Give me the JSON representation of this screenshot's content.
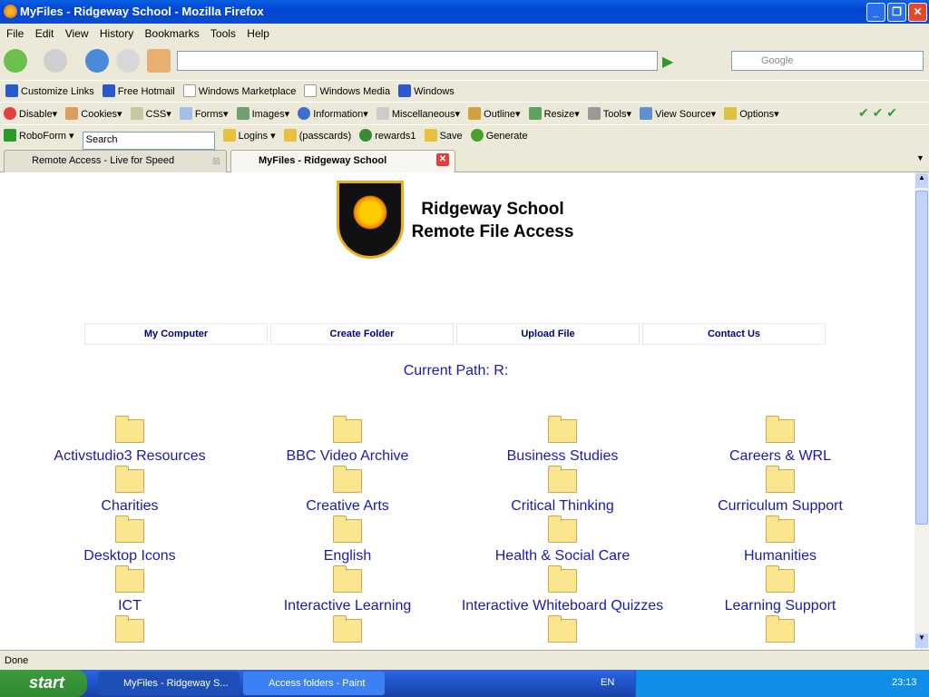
{
  "window": {
    "title": "MyFiles - Ridgeway School - Mozilla Firefox"
  },
  "menu": [
    "File",
    "Edit",
    "View",
    "History",
    "Bookmarks",
    "Tools",
    "Help"
  ],
  "search": {
    "placeholder": "Google"
  },
  "bookmarks": [
    "Customize Links",
    "Free Hotmail",
    "Windows Marketplace",
    "Windows Media",
    "Windows"
  ],
  "webdev": [
    "Disable▾",
    "Cookies▾",
    "CSS▾",
    "Forms▾",
    "Images▾",
    "Information▾",
    "Miscellaneous▾",
    "Outline▾",
    "Resize▾",
    "Tools▾",
    "View Source▾",
    "Options▾"
  ],
  "roboform": {
    "name": "RoboForm",
    "search": "Search",
    "items": [
      "Logins",
      "(passcards)",
      "rewards1",
      "Save",
      "Generate"
    ]
  },
  "tabs": [
    {
      "label": "Remote Access - Live for Speed"
    },
    {
      "label": "MyFiles - Ridgeway School",
      "active": true
    }
  ],
  "page": {
    "school": "Ridgeway School",
    "subtitle": "Remote File Access",
    "nav": [
      "My Computer",
      "Create Folder",
      "Upload File",
      "Contact Us"
    ],
    "path": "Current Path: R:",
    "folders": [
      "Activstudio3 Resources",
      "BBC Video Archive",
      "Business Studies",
      "Careers & WRL",
      "Charities",
      "Creative Arts",
      "Critical Thinking",
      "Curriculum Support",
      "Desktop Icons",
      "English",
      "Health & Social Care",
      "Humanities",
      "ICT",
      "Interactive Learning",
      "Interactive Whiteboard Quizzes",
      "Learning Support",
      "",
      "",
      "",
      ""
    ],
    "link_color": "#1a1aaa"
  },
  "status": "Done",
  "taskbar": {
    "start": "start",
    "tasks": [
      "MyFiles - Ridgeway S...",
      "Access folders - Paint"
    ],
    "lang": "EN",
    "clock": "23:13"
  }
}
